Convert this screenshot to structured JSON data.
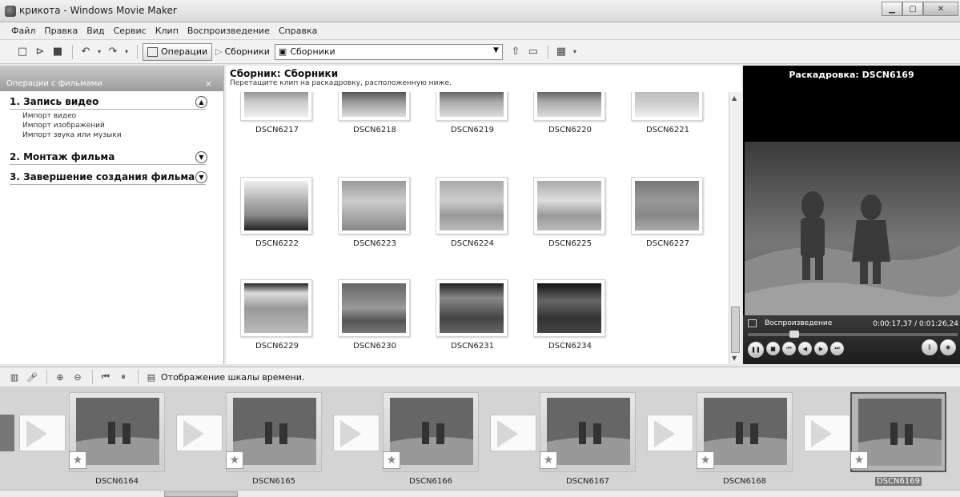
{
  "window": {
    "title": "крикота - Windows Movie Maker"
  },
  "menu": [
    "Файл",
    "Правка",
    "Вид",
    "Сервис",
    "Клип",
    "Воспроизведение",
    "Справка"
  ],
  "toolbar": {
    "operations_label": "Операции",
    "collections_label": "Сборники",
    "collection_select": "Сборники"
  },
  "taskpane": {
    "header": "Операции с фильмами",
    "close": "×",
    "sections": [
      {
        "title": "1. Запись видео",
        "links": [
          "Импорт видео",
          "Импорт изображений",
          "Импорт звука или музыки"
        ]
      },
      {
        "title": "2. Монтаж фильма",
        "links": []
      },
      {
        "title": "3. Завершение создания фильма",
        "links": []
      }
    ]
  },
  "collection": {
    "title": "Сборник: Сборники",
    "subtitle": "Перетащите клип на раскадровку, расположенную ниже.",
    "clips": [
      "DSCN6217",
      "DSCN6218",
      "DSCN6219",
      "DSCN6220",
      "DSCN6221",
      "DSCN6222",
      "DSCN6223",
      "DSCN6224",
      "DSCN6225",
      "DSCN6227",
      "DSCN6229",
      "DSCN6230",
      "DSCN6231",
      "DSCN6234"
    ]
  },
  "preview": {
    "title": "Раскадровка: DSCN6169",
    "mode": "Воспроизведение",
    "time": "0:00:17,37 / 0:01:26,24"
  },
  "storyboard_toolbar": {
    "timeline_label": "Отображение шкалы времени."
  },
  "storyboard": {
    "items": [
      "DSCN6164",
      "DSCN6165",
      "DSCN6166",
      "DSCN6167",
      "DSCN6168",
      "DSCN6169"
    ],
    "selected": "DSCN6169"
  }
}
